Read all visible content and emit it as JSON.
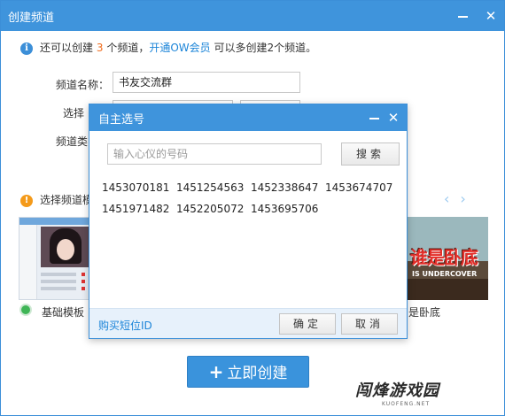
{
  "window": {
    "title": "创建频道",
    "info": {
      "prefix": "还可以创建",
      "count": "3",
      "mid": "个频道，",
      "link": "开通OW会员",
      "suffix": "可以多创建2个频道。"
    },
    "form": {
      "name_label": "频道名称：",
      "name_value": "书友交流群",
      "select_label": "选择",
      "type_label": "频道类"
    },
    "template": {
      "section_label": "选择频道模",
      "basic_label": "基础模板",
      "game_label": "是卧底",
      "game_title": "谁是卧底",
      "game_sub": "IS UNDERCOVER"
    },
    "create_button": "立即创建",
    "watermark": "闯烽游戏园",
    "watermark_sub": "KUOFENG.NET"
  },
  "dialog": {
    "title": "自主选号",
    "search_placeholder": "输入心仪的号码",
    "search_button": "搜索",
    "numbers": [
      "1453070181",
      "1451254563",
      "1452338647",
      "1453674707",
      "1451971482",
      "1452205072",
      "1453695706"
    ],
    "buy_link": "购买短位ID",
    "ok_button": "确定",
    "cancel_button": "取消"
  },
  "colors": {
    "titlebar": "#3f94dc",
    "accent_orange": "#f06d1e",
    "link_blue": "#1b84d8",
    "success_green": "#3fb556"
  }
}
